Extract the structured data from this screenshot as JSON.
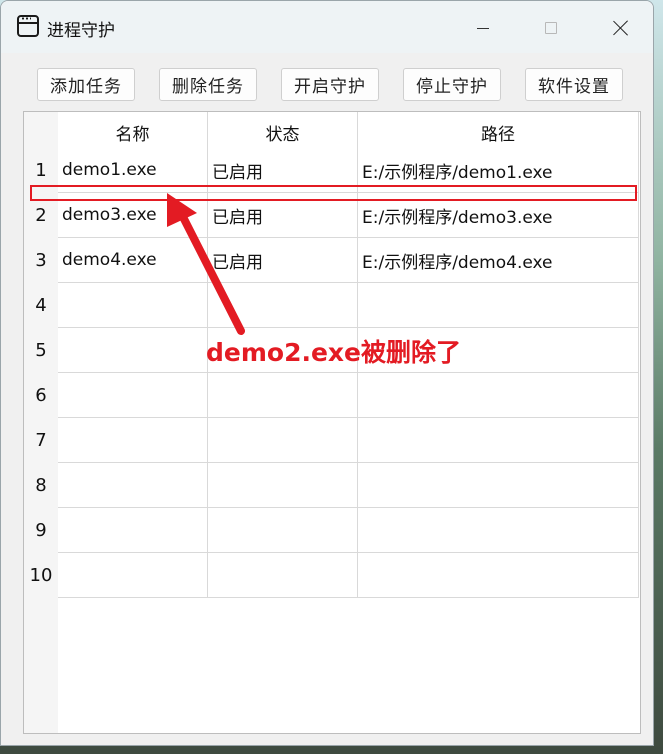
{
  "window": {
    "title": "进程守护"
  },
  "toolbar": {
    "add_task": "添加任务",
    "delete_task": "删除任务",
    "start_guard": "开启守护",
    "stop_guard": "停止守护",
    "settings": "软件设置"
  },
  "table": {
    "columns": [
      "名称",
      "状态",
      "路径"
    ],
    "rows": [
      {
        "num": "1",
        "name": "demo1.exe",
        "status": "已启用",
        "path": "E:/示例程序/demo1.exe"
      },
      {
        "num": "2",
        "name": "demo3.exe",
        "status": "已启用",
        "path": "E:/示例程序/demo3.exe"
      },
      {
        "num": "3",
        "name": "demo4.exe",
        "status": "已启用",
        "path": "E:/示例程序/demo4.exe"
      },
      {
        "num": "4",
        "name": "",
        "status": "",
        "path": ""
      },
      {
        "num": "5",
        "name": "",
        "status": "",
        "path": ""
      },
      {
        "num": "6",
        "name": "",
        "status": "",
        "path": ""
      },
      {
        "num": "7",
        "name": "",
        "status": "",
        "path": ""
      },
      {
        "num": "8",
        "name": "",
        "status": "",
        "path": ""
      },
      {
        "num": "9",
        "name": "",
        "status": "",
        "path": ""
      },
      {
        "num": "10",
        "name": "",
        "status": "",
        "path": ""
      }
    ]
  },
  "annotation": {
    "text": "demo2.exe被删除了",
    "color": "#e31b23"
  },
  "icons": {
    "app": "app-window-icon",
    "minimize": "minimize-icon",
    "maximize": "maximize-icon",
    "close": "close-icon"
  }
}
